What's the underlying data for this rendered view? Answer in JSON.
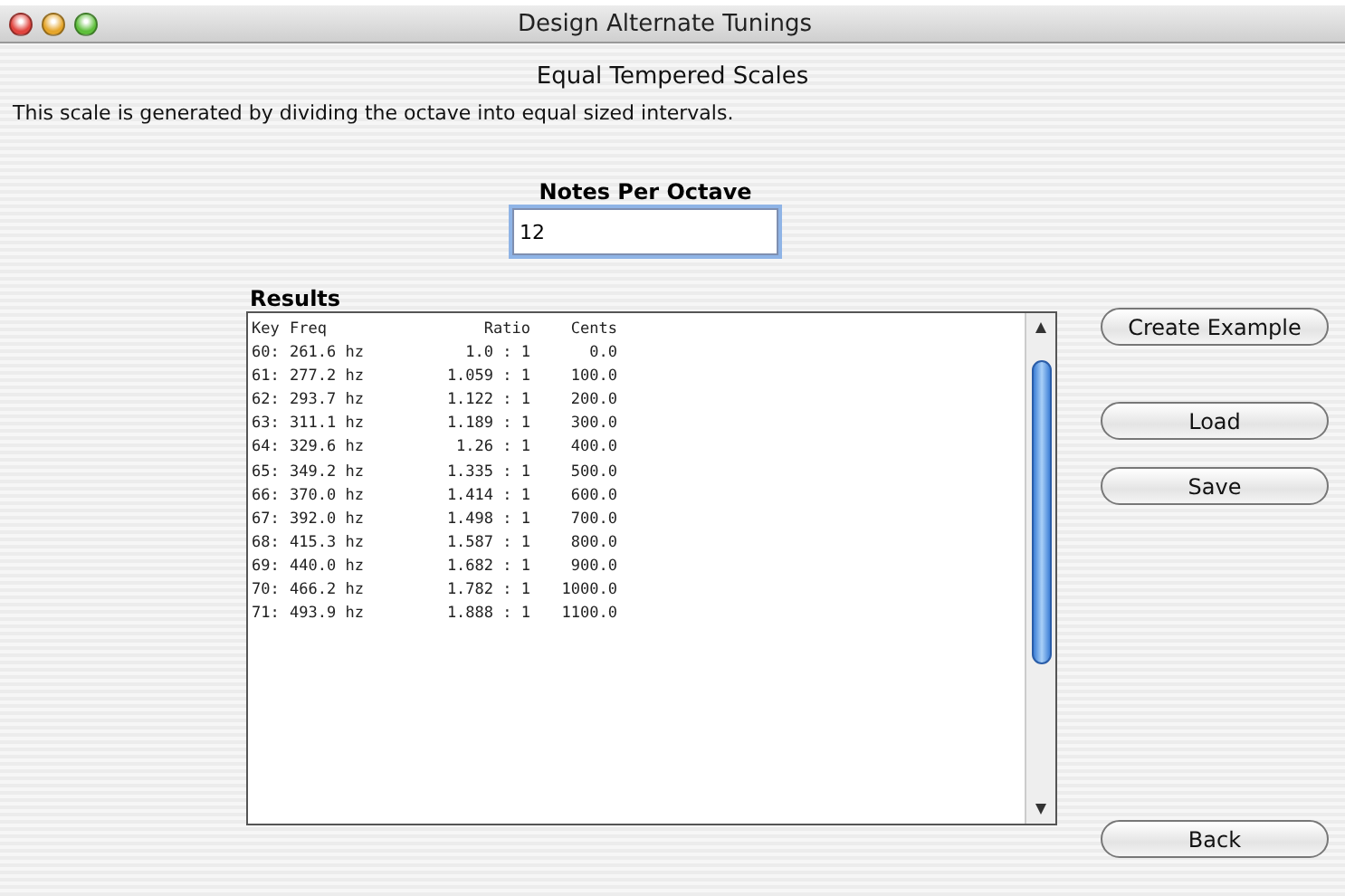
{
  "window": {
    "title": "Design Alternate Tunings"
  },
  "heading": "Equal Tempered Scales",
  "description": "This scale is generated by dividing the octave into equal sized intervals.",
  "notes_per_octave": {
    "label": "Notes Per Octave",
    "value": "12"
  },
  "results": {
    "label": "Results",
    "columns": [
      "Key",
      "Freq",
      "Ratio",
      "Cents"
    ],
    "rows": [
      [
        "60:",
        "261.6 hz",
        "1.0 : 1",
        "0.0"
      ],
      [
        "61:",
        "277.2 hz",
        "1.059 : 1",
        "100.0"
      ],
      [
        "62:",
        "293.7 hz",
        "1.122 : 1",
        "200.0"
      ],
      [
        "63:",
        "311.1 hz",
        "1.189 : 1",
        "300.0"
      ],
      [
        "64:",
        "329.6 hz",
        "1.26 : 1",
        "400.0"
      ],
      [
        "65:",
        "349.2 hz",
        "1.335 : 1",
        "500.0"
      ],
      [
        "66:",
        "370.0 hz",
        "1.414 : 1",
        "600.0"
      ],
      [
        "67:",
        "392.0 hz",
        "1.498 : 1",
        "700.0"
      ],
      [
        "68:",
        "415.3 hz",
        "1.587 : 1",
        "800.0"
      ],
      [
        "69:",
        "440.0 hz",
        "1.682 : 1",
        "900.0"
      ],
      [
        "70:",
        "466.2 hz",
        "1.782 : 1",
        "1000.0"
      ],
      [
        "71:",
        "493.9 hz",
        "1.888 : 1",
        "1100.0"
      ]
    ]
  },
  "buttons": [
    "Create Example",
    "Load",
    "Save"
  ],
  "back_button": "Back"
}
